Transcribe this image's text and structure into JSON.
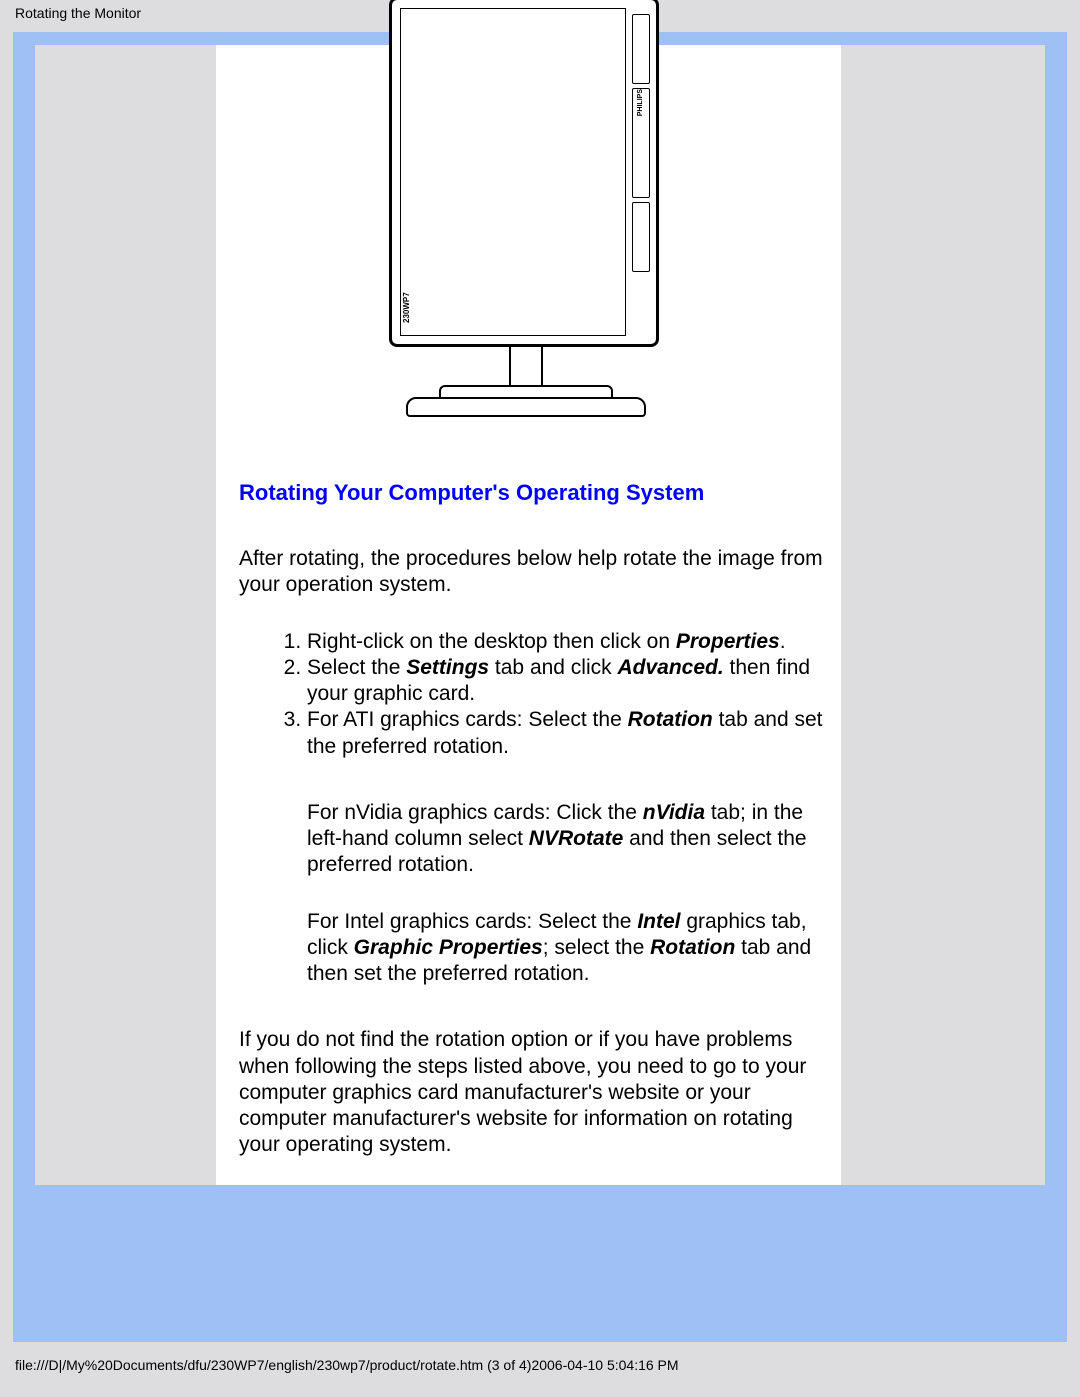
{
  "header": {
    "title": "Rotating the Monitor"
  },
  "section": {
    "heading": "Rotating Your Computer's Operating System",
    "intro": "After rotating, the procedures below help rotate the image from your operation system.",
    "steps": {
      "s1_pre": "Right-click on the desktop then click on ",
      "s1_b1": "Properties",
      "s1_post": ".",
      "s2_pre": "Select the ",
      "s2_b1": "Settings",
      "s2_mid1": " tab and click ",
      "s2_b2": "Advanced.",
      "s2_post": " then find your graphic card.",
      "s3_pre": "For ATI graphics cards: Select the ",
      "s3_b1": "Rotation",
      "s3_post": " tab and set the preferred rotation."
    },
    "nvidia": {
      "pre": "For nVidia graphics cards: Click the ",
      "b1": "nVidia",
      "mid1": " tab; in the left-hand column select ",
      "b2": "NVRotate",
      "post": " and then select the preferred rotation."
    },
    "intel": {
      "pre": "For Intel graphics cards: Select the ",
      "b1": "Intel",
      "mid1": " graphics tab, click ",
      "b2": "Graphic Properties",
      "mid2": "; select the ",
      "b3": "Rotation",
      "post": " tab and then set the preferred rotation."
    },
    "outro": "If you do not find the rotation option or if you have problems when following the steps listed above, you need to go to your computer graphics card manufacturer's website or your computer manufacturer's website for information on rotating your operating system."
  },
  "footer": {
    "path": "file:///D|/My%20Documents/dfu/230WP7/english/230wp7/product/rotate.htm (3 of 4)2006-04-10 5:04:16 PM"
  },
  "monitor": {
    "brand": "PHILIPS"
  }
}
